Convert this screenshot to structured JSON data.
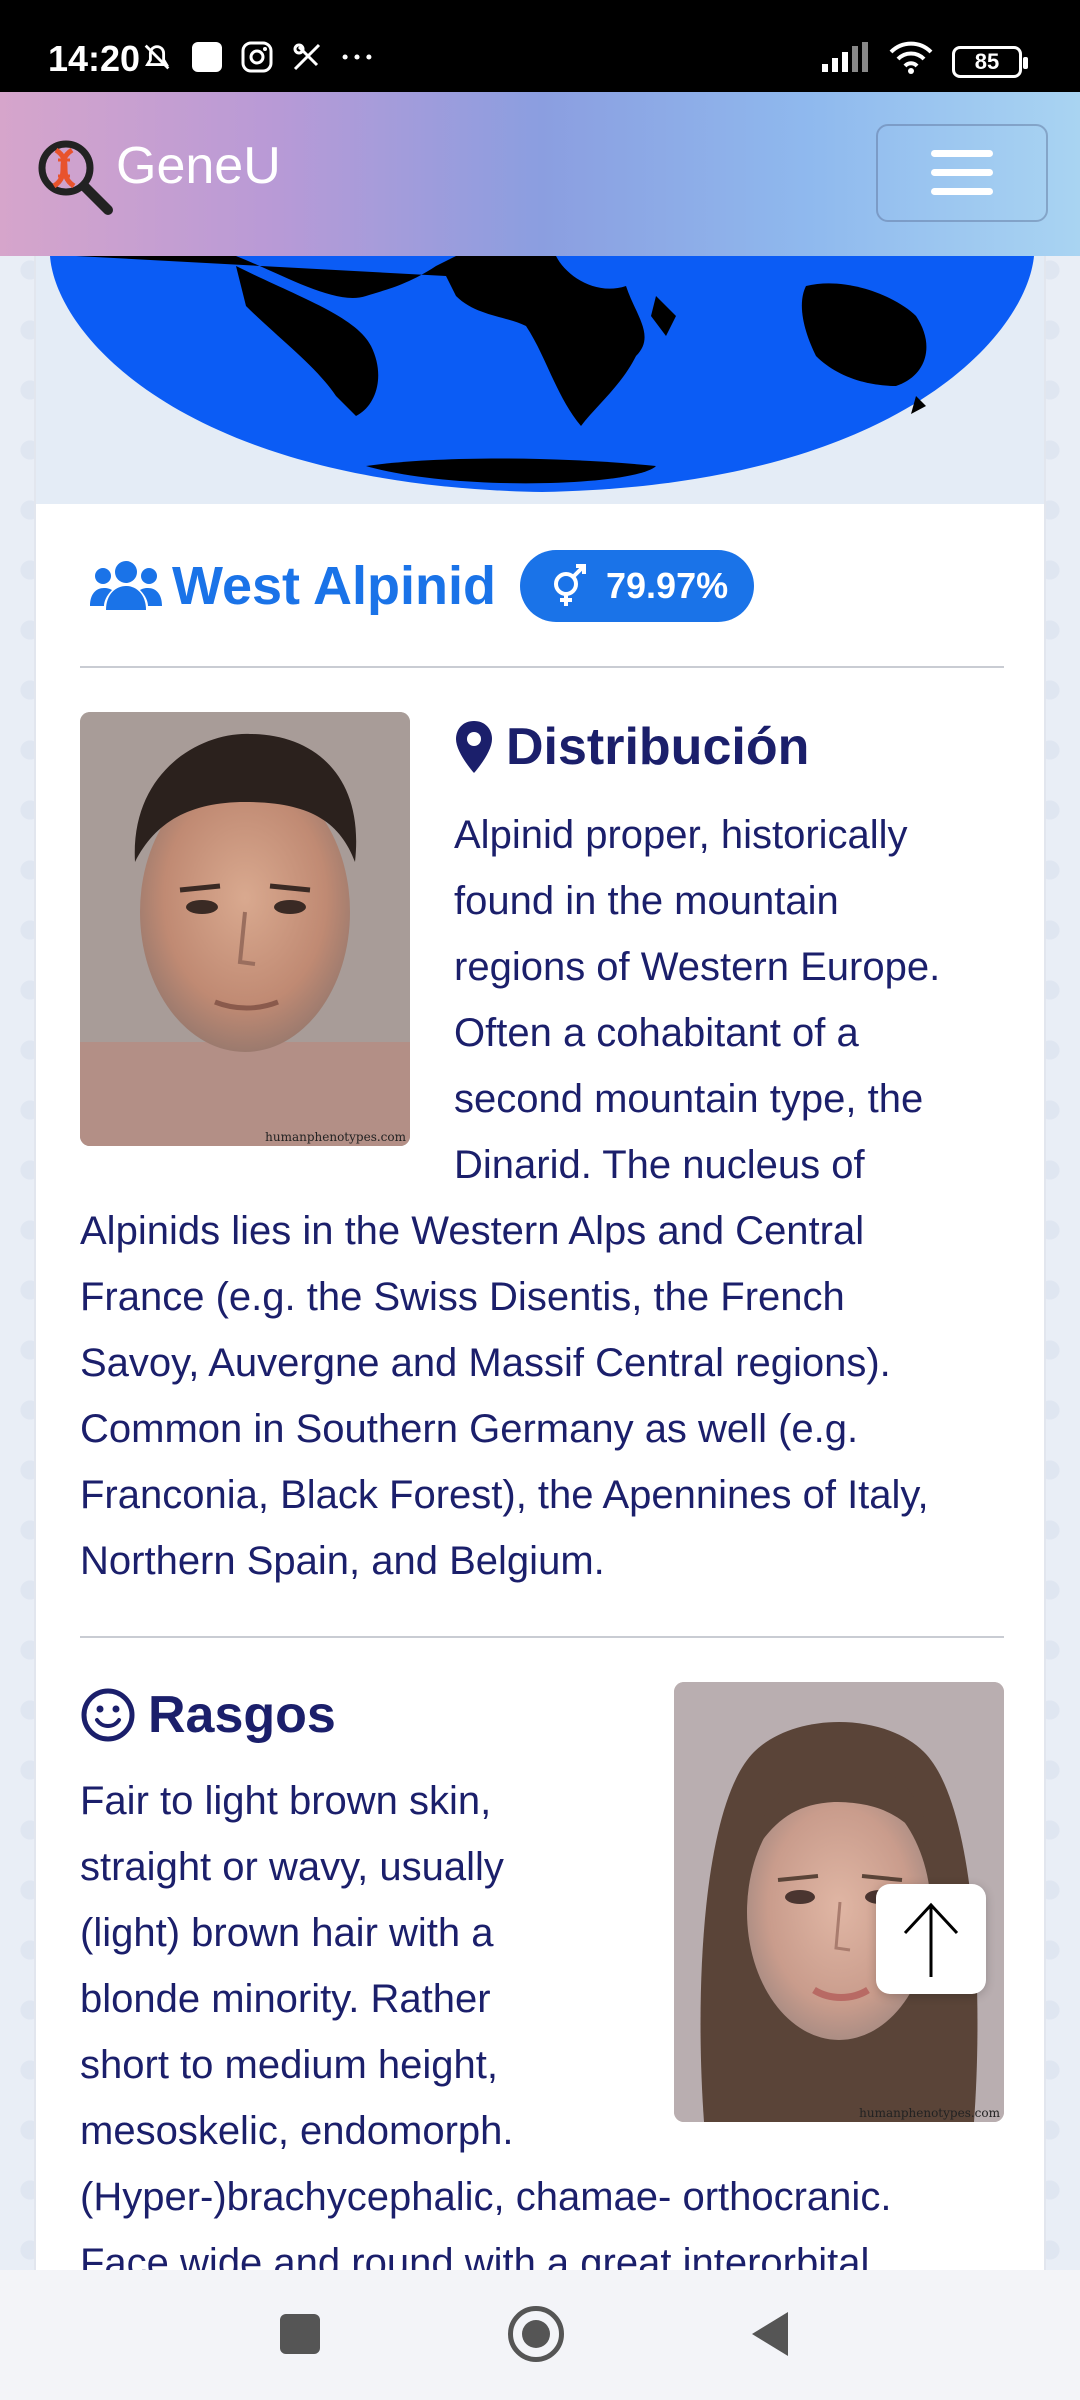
{
  "status_bar": {
    "time": "14:20",
    "battery": "85"
  },
  "header": {
    "brand": "GeneU"
  },
  "phenotype": {
    "name": "West Alpinid",
    "percentage": "79.97%"
  },
  "distribution": {
    "heading": "Distribución",
    "lines": [
      "Alpinid proper, historically",
      "found in the mountain",
      "regions of Western Europe.",
      "Often a cohabitant of a",
      "second mountain type, the",
      "Dinarid. The nucleus of",
      "Alpinids lies in the Western Alps and Central",
      "France (e.g. the Swiss Disentis, the French",
      "Savoy, Auvergne and Massif Central regions).",
      "Common in Southern Germany as well (e.g.",
      "Franconia, Black Forest), the Apennines of Italy,",
      "Northern Spain, and Belgium."
    ]
  },
  "traits": {
    "heading": "Rasgos",
    "lines": [
      "Fair to light brown skin,",
      "straight or wavy, usually",
      "(light) brown hair with a",
      "blonde minority. Rather",
      "short to medium height,",
      "mesoskelic, endomorph.",
      "(Hyper-)brachycephalic, chamae- orthocranic.",
      "Face wide and round with a great interorbital"
    ]
  },
  "images": {
    "watermark": "humanphenotypes.com"
  },
  "icons": {
    "logo": "dna-magnifier-icon",
    "menu": "hamburger-menu-icon",
    "people": "users-icon",
    "gender": "mars-venus-icon",
    "location": "map-pin-icon",
    "smile": "smile-icon",
    "to_top": "arrow-up-icon"
  },
  "colors": {
    "accent": "#1a73e8",
    "text": "#1b1f6b"
  }
}
